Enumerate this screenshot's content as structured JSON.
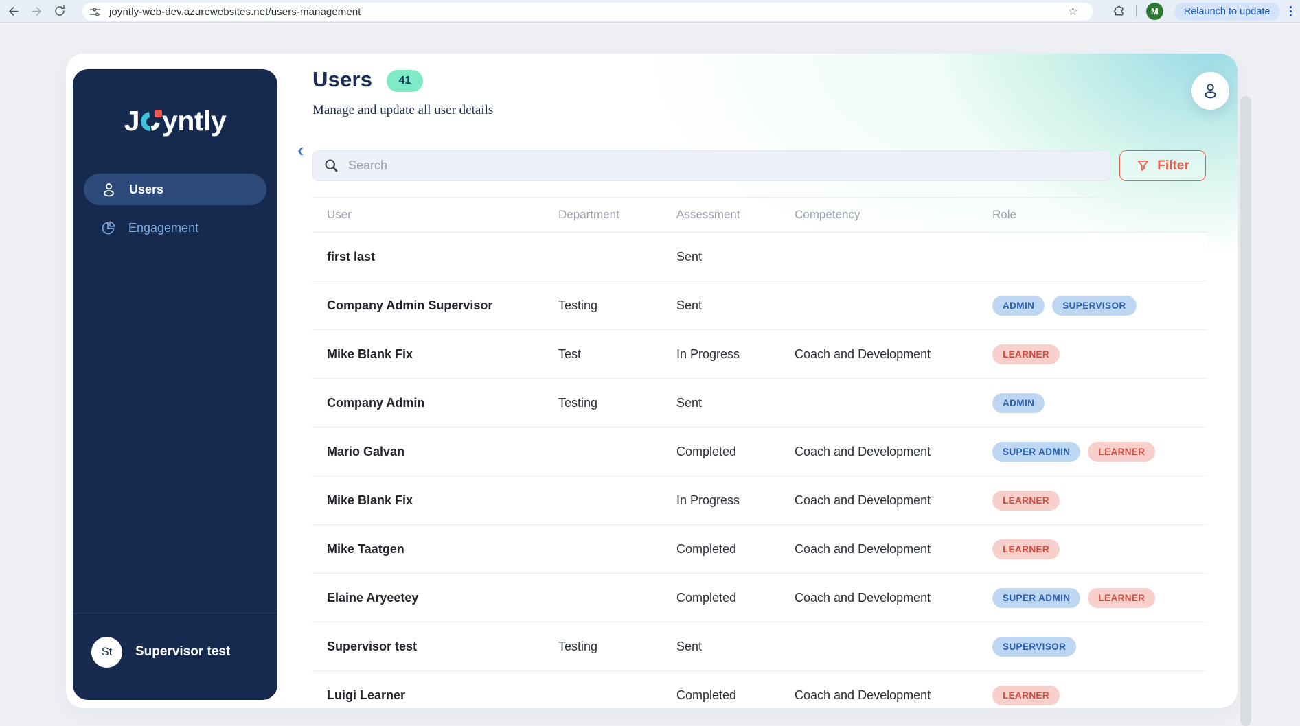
{
  "browser": {
    "url": "joyntly-web-dev.azurewebsites.net/users-management",
    "relaunch_label": "Relaunch to update",
    "avatar_letter": "M"
  },
  "sidebar": {
    "logo_prefix": "J",
    "logo_suffix": "yntly",
    "items": [
      {
        "label": "Users",
        "active": true
      },
      {
        "label": "Engagement",
        "active": false
      }
    ],
    "footer": {
      "avatar_initials": "St",
      "name": "Supervisor test"
    }
  },
  "header": {
    "title": "Users",
    "count": "41",
    "subtitle": "Manage and update all user details"
  },
  "toolbar": {
    "search_placeholder": "Search",
    "filter_label": "Filter"
  },
  "table": {
    "columns": [
      "User",
      "Department",
      "Assessment",
      "Competency",
      "Role"
    ],
    "rows": [
      {
        "user": "first last",
        "department": "",
        "assessment": "Sent",
        "competency": "",
        "roles": []
      },
      {
        "user": "Company Admin Supervisor",
        "department": "Testing",
        "assessment": "Sent",
        "competency": "",
        "roles": [
          {
            "label": "ADMIN",
            "type": "blue"
          },
          {
            "label": "SUPERVISOR",
            "type": "blue"
          }
        ]
      },
      {
        "user": "Mike Blank Fix",
        "department": "Test",
        "assessment": "In Progress",
        "competency": "Coach and Development",
        "roles": [
          {
            "label": "LEARNER",
            "type": "red"
          }
        ]
      },
      {
        "user": "Company Admin",
        "department": "Testing",
        "assessment": "Sent",
        "competency": "",
        "roles": [
          {
            "label": "ADMIN",
            "type": "blue"
          }
        ]
      },
      {
        "user": "Mario Galvan",
        "department": "",
        "assessment": "Completed",
        "competency": "Coach and Development",
        "roles": [
          {
            "label": "SUPER ADMIN",
            "type": "blue"
          },
          {
            "label": "LEARNER",
            "type": "red"
          }
        ]
      },
      {
        "user": "Mike Blank Fix",
        "department": "",
        "assessment": "In Progress",
        "competency": "Coach and Development",
        "roles": [
          {
            "label": "LEARNER",
            "type": "red"
          }
        ]
      },
      {
        "user": "Mike Taatgen",
        "department": "",
        "assessment": "Completed",
        "competency": "Coach and Development",
        "roles": [
          {
            "label": "LEARNER",
            "type": "red"
          }
        ]
      },
      {
        "user": "Elaine Aryeetey",
        "department": "",
        "assessment": "Completed",
        "competency": "Coach and Development",
        "roles": [
          {
            "label": "SUPER ADMIN",
            "type": "blue"
          },
          {
            "label": "LEARNER",
            "type": "red"
          }
        ]
      },
      {
        "user": "Supervisor test",
        "department": "Testing",
        "assessment": "Sent",
        "competency": "",
        "roles": [
          {
            "label": "SUPERVISOR",
            "type": "blue"
          }
        ]
      },
      {
        "user": "Luigi Learner",
        "department": "",
        "assessment": "Completed",
        "competency": "Coach and Development",
        "roles": [
          {
            "label": "LEARNER",
            "type": "red"
          }
        ]
      }
    ]
  },
  "icons": {
    "back-icon": "left-arrow",
    "forward-icon": "right-arrow",
    "reload-icon": "circular-arrow",
    "site-settings-icon": "tune-sliders",
    "bookmark-icon": "star-outline",
    "extensions-icon": "puzzle-piece",
    "browser-menu-icon": "vertical-dots",
    "collapse-icon": "chevron-left",
    "users-icon": "person-outline",
    "engagement-icon": "pie-chart",
    "profile-icon": "person-outline",
    "search-icon": "magnifier",
    "filter-icon": "funnel"
  },
  "colors": {
    "sidebar_bg": "#152a4e",
    "active_nav_bg": "#2d4b7a",
    "nav_inactive_text": "#7fa9e0",
    "accent_coral": "#f25c4d",
    "count_badge_bg": "#7eeac8",
    "title_navy": "#1c2f58",
    "badge_blue_bg": "#bdd7f3",
    "badge_blue_text": "#2d5faf",
    "badge_red_bg": "#f8cfca",
    "badge_red_text": "#cf4a3e",
    "avatar_green": "#2c7a33",
    "relaunch_blue": "#1a5dbe"
  }
}
